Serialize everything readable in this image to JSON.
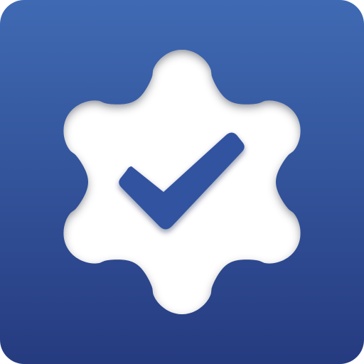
{
  "icon": {
    "name": "gear-check-app-icon",
    "symbol": "gear-icon",
    "overlay": "checkmark-icon"
  },
  "colors": {
    "background_top": "#3f6ab3",
    "background_bottom": "#263b80",
    "gear": "#ffffff",
    "checkmark": "#3352a0"
  }
}
